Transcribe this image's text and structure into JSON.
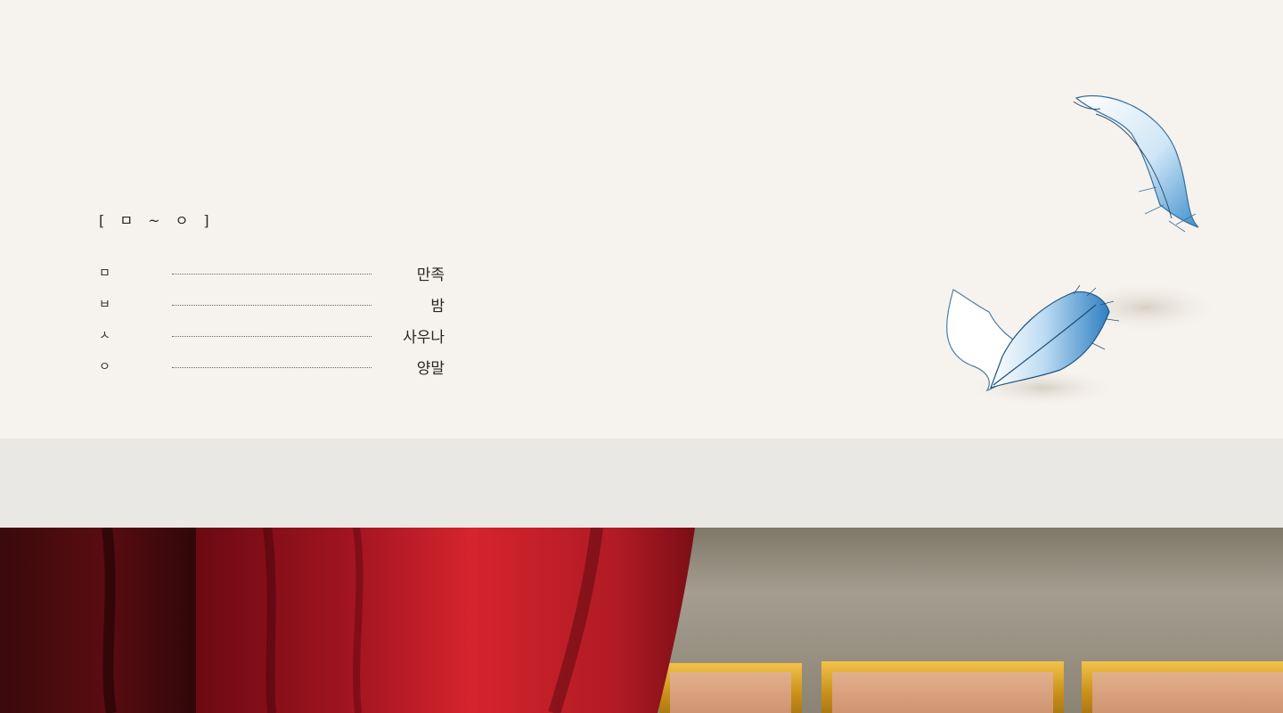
{
  "index": {
    "heading": "[ ㅁ ~ ㅇ ]",
    "entries": [
      {
        "key": "ㅁ",
        "value": "만족"
      },
      {
        "key": "ㅂ",
        "value": "밤"
      },
      {
        "key": "ㅅ",
        "value": "사우나"
      },
      {
        "key": "ㅇ",
        "value": "양말"
      }
    ]
  },
  "colors": {
    "page_background": "#f6f3ee",
    "band": "#eae8e4",
    "curtain_red": "#a0141c",
    "frame_gold": "#c9971e",
    "feather_blue": "#4f9fd8"
  },
  "icons": [
    "feather-icon",
    "curtain-illustration",
    "gold-frame"
  ]
}
